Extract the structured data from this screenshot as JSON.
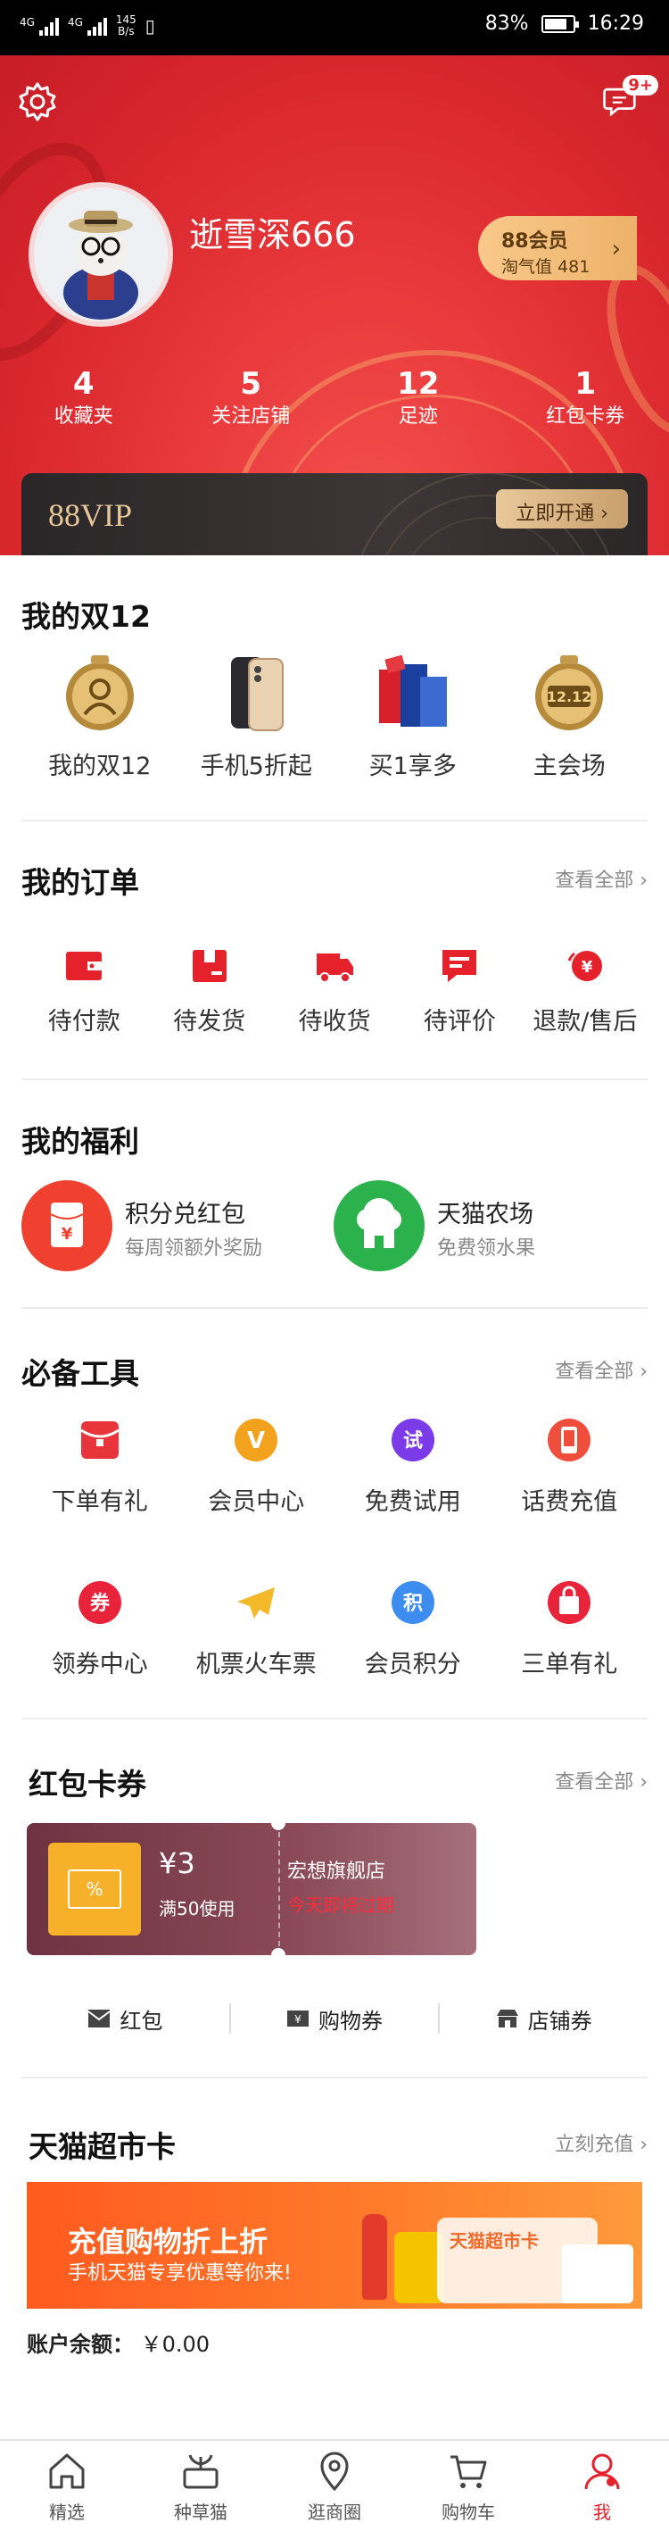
{
  "status_bar": {
    "signal1": "4G",
    "signal2": "4G",
    "net_speed_value": "145",
    "net_speed_unit": "B/s",
    "battery": "83%",
    "time": "16:29"
  },
  "header": {
    "message_badge": "9+",
    "username": "逝雪深666",
    "vip_badge": "88会员",
    "taoqi_value": "淘气值 481",
    "stats": [
      {
        "num": "4",
        "label": "收藏夹"
      },
      {
        "num": "5",
        "label": "关注店铺"
      },
      {
        "num": "12",
        "label": "足迹"
      },
      {
        "num": "1",
        "label": "红包卡券"
      }
    ],
    "vip_logo": "88VIP",
    "vip_open": "立即开通 ›"
  },
  "double12": {
    "title": "我的双12",
    "items": [
      {
        "label": "我的双12",
        "icon": "medal-icon"
      },
      {
        "label": "手机5折起",
        "icon": "phone-icon"
      },
      {
        "label": "买1享多",
        "icon": "gift-pack-icon"
      },
      {
        "label": "主会场",
        "icon": "medal-1212-icon"
      }
    ]
  },
  "orders": {
    "title": "我的订单",
    "more": "查看全部",
    "items": [
      {
        "label": "待付款",
        "icon": "wallet-icon"
      },
      {
        "label": "待发货",
        "icon": "box-icon"
      },
      {
        "label": "待收货",
        "icon": "truck-icon"
      },
      {
        "label": "待评价",
        "icon": "comment-icon"
      },
      {
        "label": "退款/售后",
        "icon": "refund-icon"
      }
    ]
  },
  "welfare": {
    "title": "我的福利",
    "items": [
      {
        "title": "积分兑红包",
        "sub": "每周领额外奖励",
        "icon": "red-envelope-icon",
        "color": "#f0402f"
      },
      {
        "title": "天猫农场",
        "sub": "免费领水果",
        "icon": "farm-icon",
        "color": "#2bb24c"
      }
    ]
  },
  "tools": {
    "title": "必备工具",
    "more": "查看全部",
    "items": [
      {
        "label": "下单有礼",
        "icon": "gift-envelope-icon",
        "glyph": "",
        "color": "#e8353c"
      },
      {
        "label": "会员中心",
        "icon": "vip-v-icon",
        "glyph": "V",
        "color": "#f3a21d"
      },
      {
        "label": "免费试用",
        "icon": "trial-icon",
        "glyph": "试",
        "color": "#7b3be8"
      },
      {
        "label": "话费充值",
        "icon": "mobile-recharge-icon",
        "glyph": "",
        "color": "#f04e3d"
      },
      {
        "label": "领券中心",
        "icon": "coupon-icon",
        "glyph": "券",
        "color": "#e8233a"
      },
      {
        "label": "机票火车票",
        "icon": "plane-icon",
        "glyph": "✈",
        "color": "#f4b92b"
      },
      {
        "label": "会员积分",
        "icon": "points-icon",
        "glyph": "积",
        "color": "#3d8cf0"
      },
      {
        "label": "三单有礼",
        "icon": "shopping-bag-icon",
        "glyph": "",
        "color": "#e8233a"
      }
    ]
  },
  "coupons": {
    "title": "红包卡券",
    "more": "查看全部",
    "card": {
      "amount": "¥3",
      "condition": "满50使用",
      "shop": "宏想旗舰店",
      "expire": "今天即将过期"
    },
    "tabs": [
      {
        "label": "红包",
        "icon": "envelope-icon"
      },
      {
        "label": "购物券",
        "icon": "voucher-icon"
      },
      {
        "label": "店铺券",
        "icon": "store-icon"
      }
    ]
  },
  "supermarket": {
    "title": "天猫超市卡",
    "more": "立刻充值",
    "banner_title": "充值购物折上折",
    "banner_sub": "手机天猫专享优惠等你来!",
    "card_label": "天猫超市卡",
    "balance_label": "账户余额：",
    "balance_value": "￥0.00"
  },
  "tabbar": [
    {
      "label": "精选",
      "icon": "home-icon"
    },
    {
      "label": "种草猫",
      "icon": "grass-box-icon"
    },
    {
      "label": "逛商圈",
      "icon": "location-icon"
    },
    {
      "label": "购物车",
      "icon": "cart-icon"
    },
    {
      "label": "我",
      "icon": "me-icon",
      "active": true
    }
  ]
}
